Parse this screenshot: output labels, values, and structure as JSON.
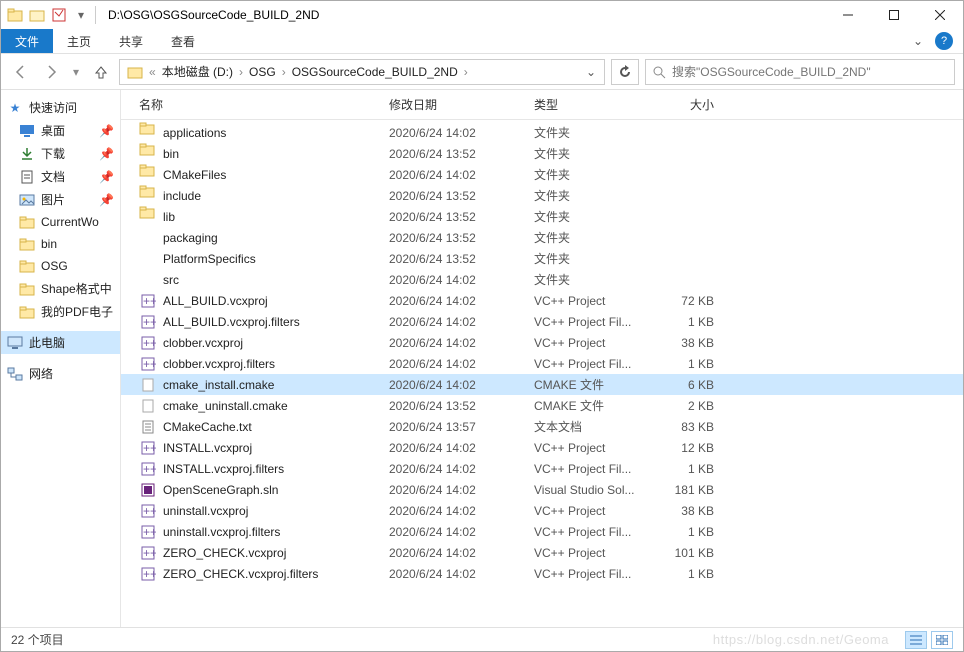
{
  "titlebar": {
    "path": "D:\\OSG\\OSGSourceCode_BUILD_2ND"
  },
  "ribbon": {
    "file": "文件",
    "tabs": [
      "主页",
      "共享",
      "查看"
    ]
  },
  "breadcrumb": [
    "本地磁盘 (D:)",
    "OSG",
    "OSGSourceCode_BUILD_2ND"
  ],
  "search_placeholder": "搜索\"OSGSourceCode_BUILD_2ND\"",
  "nav": {
    "quick": {
      "label": "快速访问",
      "items": [
        {
          "label": "桌面",
          "icon": "desktop",
          "pinned": true
        },
        {
          "label": "下载",
          "icon": "download",
          "pinned": true
        },
        {
          "label": "文档",
          "icon": "doc",
          "pinned": true
        },
        {
          "label": "图片",
          "icon": "pic",
          "pinned": true
        },
        {
          "label": "CurrentWo",
          "icon": "folder",
          "pinned": false
        },
        {
          "label": "bin",
          "icon": "folder",
          "pinned": false
        },
        {
          "label": "OSG",
          "icon": "folder",
          "pinned": false
        },
        {
          "label": "Shape格式中",
          "icon": "folder",
          "pinned": false
        },
        {
          "label": "我的PDF电子",
          "icon": "folder",
          "pinned": false
        }
      ]
    },
    "thispc": "此电脑",
    "network": "网络"
  },
  "columns": {
    "name": "名称",
    "date": "修改日期",
    "type": "类型",
    "size": "大小"
  },
  "files": [
    {
      "name": "applications",
      "date": "2020/6/24 14:02",
      "type": "文件夹",
      "size": "",
      "icon": "folder"
    },
    {
      "name": "bin",
      "date": "2020/6/24 13:52",
      "type": "文件夹",
      "size": "",
      "icon": "folder"
    },
    {
      "name": "CMakeFiles",
      "date": "2020/6/24 14:02",
      "type": "文件夹",
      "size": "",
      "icon": "folder"
    },
    {
      "name": "include",
      "date": "2020/6/24 13:52",
      "type": "文件夹",
      "size": "",
      "icon": "folder"
    },
    {
      "name": "lib",
      "date": "2020/6/24 13:52",
      "type": "文件夹",
      "size": "",
      "icon": "folder"
    },
    {
      "name": "packaging",
      "date": "2020/6/24 13:52",
      "type": "文件夹",
      "size": "",
      "icon": "folder"
    },
    {
      "name": "PlatformSpecifics",
      "date": "2020/6/24 13:52",
      "type": "文件夹",
      "size": "",
      "icon": "folder"
    },
    {
      "name": "src",
      "date": "2020/6/24 14:02",
      "type": "文件夹",
      "size": "",
      "icon": "folder"
    },
    {
      "name": "ALL_BUILD.vcxproj",
      "date": "2020/6/24 14:02",
      "type": "VC++ Project",
      "size": "72 KB",
      "icon": "vcx"
    },
    {
      "name": "ALL_BUILD.vcxproj.filters",
      "date": "2020/6/24 14:02",
      "type": "VC++ Project Fil...",
      "size": "1 KB",
      "icon": "vcx"
    },
    {
      "name": "clobber.vcxproj",
      "date": "2020/6/24 14:02",
      "type": "VC++ Project",
      "size": "38 KB",
      "icon": "vcx"
    },
    {
      "name": "clobber.vcxproj.filters",
      "date": "2020/6/24 14:02",
      "type": "VC++ Project Fil...",
      "size": "1 KB",
      "icon": "vcx"
    },
    {
      "name": "cmake_install.cmake",
      "date": "2020/6/24 14:02",
      "type": "CMAKE 文件",
      "size": "6 KB",
      "icon": "file",
      "selected": true
    },
    {
      "name": "cmake_uninstall.cmake",
      "date": "2020/6/24 13:52",
      "type": "CMAKE 文件",
      "size": "2 KB",
      "icon": "file"
    },
    {
      "name": "CMakeCache.txt",
      "date": "2020/6/24 13:57",
      "type": "文本文档",
      "size": "83 KB",
      "icon": "txt"
    },
    {
      "name": "INSTALL.vcxproj",
      "date": "2020/6/24 14:02",
      "type": "VC++ Project",
      "size": "12 KB",
      "icon": "vcx"
    },
    {
      "name": "INSTALL.vcxproj.filters",
      "date": "2020/6/24 14:02",
      "type": "VC++ Project Fil...",
      "size": "1 KB",
      "icon": "vcx"
    },
    {
      "name": "OpenSceneGraph.sln",
      "date": "2020/6/24 14:02",
      "type": "Visual Studio Sol...",
      "size": "181 KB",
      "icon": "sln"
    },
    {
      "name": "uninstall.vcxproj",
      "date": "2020/6/24 14:02",
      "type": "VC++ Project",
      "size": "38 KB",
      "icon": "vcx"
    },
    {
      "name": "uninstall.vcxproj.filters",
      "date": "2020/6/24 14:02",
      "type": "VC++ Project Fil...",
      "size": "1 KB",
      "icon": "vcx"
    },
    {
      "name": "ZERO_CHECK.vcxproj",
      "date": "2020/6/24 14:02",
      "type": "VC++ Project",
      "size": "101 KB",
      "icon": "vcx"
    },
    {
      "name": "ZERO_CHECK.vcxproj.filters",
      "date": "2020/6/24 14:02",
      "type": "VC++ Project Fil...",
      "size": "1 KB",
      "icon": "vcx"
    }
  ],
  "status": "22 个项目",
  "watermark": "https://blog.csdn.net/Geoma"
}
